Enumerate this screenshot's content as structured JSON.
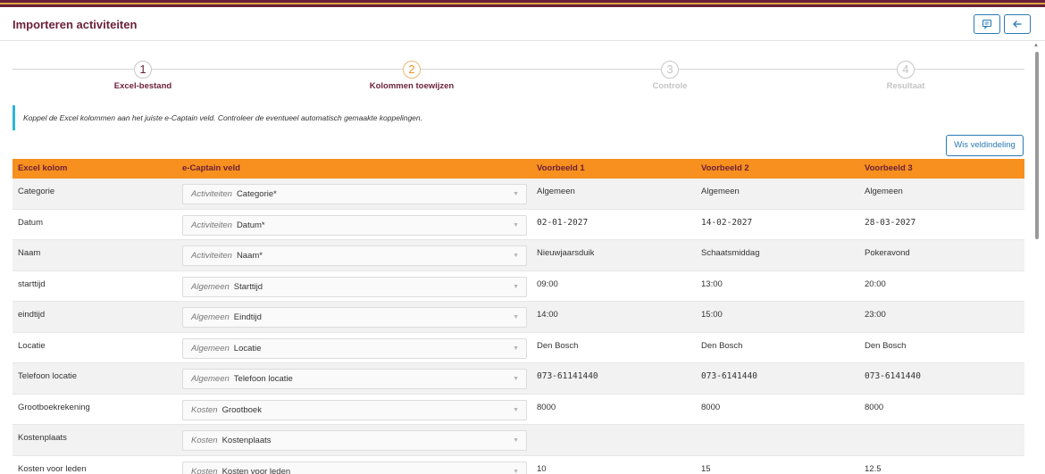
{
  "page": {
    "title": "Importeren activiteiten"
  },
  "header_icons": [
    "comment-icon",
    "back-arrow-icon"
  ],
  "steps": [
    {
      "number": "1",
      "label": "Excel-bestand",
      "state": "done"
    },
    {
      "number": "2",
      "label": "Kolommen toewijzen",
      "state": "active"
    },
    {
      "number": "3",
      "label": "Controle",
      "state": "todo"
    },
    {
      "number": "4",
      "label": "Resultaat",
      "state": "todo"
    }
  ],
  "info": "Koppel de Excel kolommen aan het juiste e-Captain veld. Controleer de eventueel automatisch gemaakte koppelingen.",
  "wis_button": "Wis veldindeling",
  "table": {
    "headers": [
      "Excel kolom",
      "e-Captain veld",
      "Voorbeeld 1",
      "Voorbeeld 2",
      "Voorbeeld 3"
    ],
    "rows": [
      {
        "excel": "Categorie",
        "group": "Activiteiten",
        "field": "Categorie*",
        "v1": "Algemeen",
        "v2": "Algemeen",
        "v3": "Algemeen"
      },
      {
        "excel": "Datum",
        "group": "Activiteiten",
        "field": "Datum*",
        "v1": "02-01-2027",
        "v2": "14-02-2027",
        "v3": "28-03-2027"
      },
      {
        "excel": "Naam",
        "group": "Activiteiten",
        "field": "Naam*",
        "v1": "Nieuwjaarsduik",
        "v2": "Schaatsmiddag",
        "v3": "Pokeravond"
      },
      {
        "excel": "starttijd",
        "group": "Algemeen",
        "field": "Starttijd",
        "v1": "09:00",
        "v2": "13:00",
        "v3": "20:00"
      },
      {
        "excel": "eindtijd",
        "group": "Algemeen",
        "field": "Eindtijd",
        "v1": "14:00",
        "v2": "15:00",
        "v3": "23:00"
      },
      {
        "excel": "Locatie",
        "group": "Algemeen",
        "field": "Locatie",
        "v1": "Den Bosch",
        "v2": "Den Bosch",
        "v3": "Den Bosch"
      },
      {
        "excel": "Telefoon locatie",
        "group": "Algemeen",
        "field": "Telefoon locatie",
        "v1": "073-61141440",
        "v2": "073-6141440",
        "v3": "073-6141440"
      },
      {
        "excel": "Grootboekrekening",
        "group": "Kosten",
        "field": "Grootboek",
        "v1": "8000",
        "v2": "8000",
        "v3": "8000"
      },
      {
        "excel": "Kostenplaats",
        "group": "Kosten",
        "field": "Kostenplaats",
        "v1": "",
        "v2": "",
        "v3": ""
      },
      {
        "excel": "Kosten voor leden",
        "group": "Kosten",
        "field": "Kosten voor leden",
        "v1": "10",
        "v2": "15",
        "v3": "12.5"
      }
    ]
  },
  "colors": {
    "brand": "#6a1f3a",
    "table_header_bg": "#f7901e",
    "info_accent": "#29b6d9",
    "button_blue": "#2a7ab5"
  }
}
